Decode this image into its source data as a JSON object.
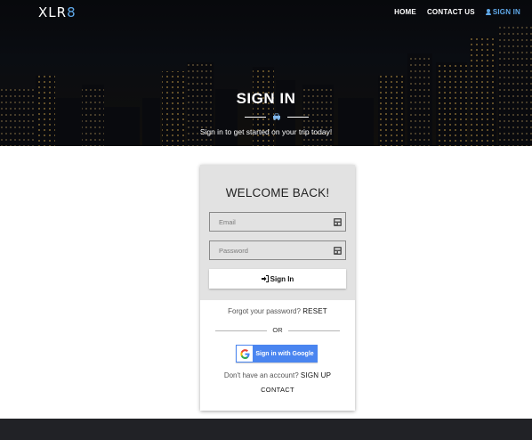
{
  "brand": {
    "logo_main": "XLR",
    "logo_accent": "8"
  },
  "nav": {
    "items": [
      {
        "label": "HOME"
      },
      {
        "label": "CONTACT US"
      },
      {
        "label": "SIGN IN",
        "icon": "user-icon"
      }
    ]
  },
  "hero": {
    "title": "SIGN IN",
    "divider_icon": "car-icon",
    "subtitle": "Sign in to get started on your trip today!"
  },
  "card": {
    "title": "WELCOME BACK!",
    "email_placeholder": "Email",
    "password_placeholder": "Password",
    "field_icon": "keyboard-icon",
    "signin_label": "Sign In",
    "forgot_text": "Forgot your password?",
    "forgot_link": "RESET",
    "or_text": "OR",
    "google_label": "Sign in with Google",
    "signup_text": "Don't have an account?",
    "signup_link": "SIGN UP",
    "contact_label": "CONTACT"
  },
  "colors": {
    "accent": "#5fa8e8",
    "google_blue": "#4a85f0",
    "card_top": "#e2e2e2",
    "footer": "#212226"
  }
}
